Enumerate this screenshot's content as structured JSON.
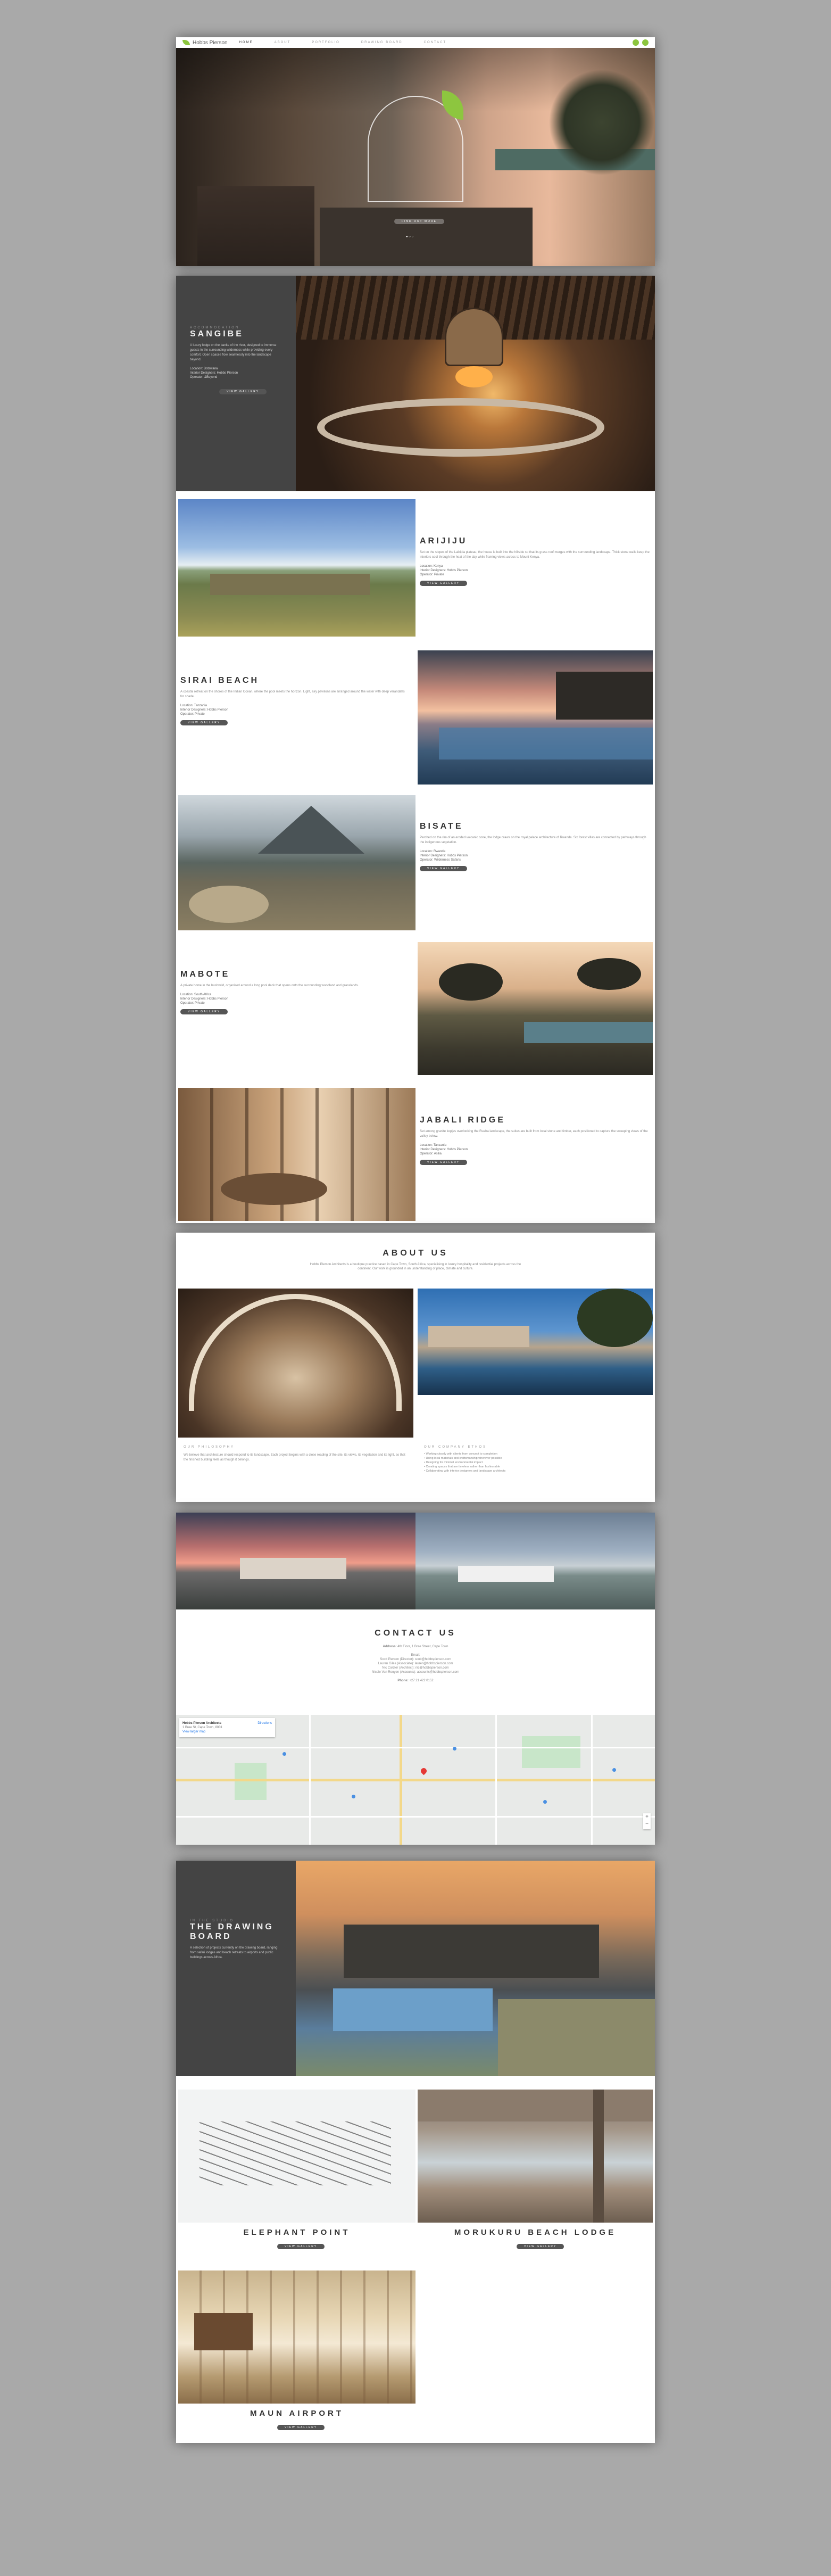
{
  "nav": {
    "logo": "Hobbs Pierson",
    "links": [
      "HOME",
      "ABOUT",
      "PORTFOLIO",
      "DRAWING BOARD",
      "CONTACT"
    ]
  },
  "hero": {
    "button": "FIND OUT MORE",
    "dots": "● ○ ○"
  },
  "sanctuary": {
    "eyebrow": "ACCOMMODATION",
    "title": "SANGIBE",
    "body": "A luxury lodge on the banks of the river, designed to immerse guests in the surrounding wilderness while providing every comfort. Open spaces flow seamlessly into the landscape beyond.",
    "location": "Location: Botswana",
    "interior": "Interior Designers: Hobbs Pierson",
    "operator": "Operator: &Beyond",
    "button": "VIEW GALLERY"
  },
  "projects": [
    {
      "title": "ARIJIJU",
      "body": "Set on the slopes of the Laikipia plateau, the house is built into the hillside so that its grass roof merges with the surrounding landscape. Thick stone walls keep the interiors cool through the heat of the day while framing views across to Mount Kenya.",
      "location": "Location: Kenya",
      "interior": "Interior Designers: Hobbs Pierson",
      "operator": "Operator: Private",
      "button": "VIEW GALLERY"
    },
    {
      "title": "SIRAI BEACH",
      "body": "A coastal retreat on the shores of the Indian Ocean, where the pool meets the horizon. Light, airy pavilions are arranged around the water with deep verandahs for shade.",
      "location": "Location: Tanzania",
      "interior": "Interior Designers: Hobbs Pierson",
      "operator": "Operator: Private",
      "button": "VIEW GALLERY"
    },
    {
      "title": "BISATE",
      "body": "Perched on the rim of an eroded volcanic cone, the lodge draws on the royal palace architecture of Rwanda. Six forest villas are connected by pathways through the indigenous vegetation.",
      "location": "Location: Rwanda",
      "interior": "Interior Designers: Hobbs Pierson",
      "operator": "Operator: Wilderness Safaris",
      "button": "VIEW GALLERY"
    },
    {
      "title": "MABOTE",
      "body": "A private home in the bushveld, organised around a long pool deck that opens onto the surrounding woodland and grasslands.",
      "location": "Location: South Africa",
      "interior": "Interior Designers: Hobbs Pierson",
      "operator": "Operator: Private",
      "button": "VIEW GALLERY"
    },
    {
      "title": "JABALI RIDGE",
      "body": "Set among granite kopjes overlooking the Ruaha landscape, the suites are built from local stone and timber, each positioned to capture the sweeping views of the valley below.",
      "location": "Location: Tanzania",
      "interior": "Interior Designers: Hobbs Pierson",
      "operator": "Operator: Asilia",
      "button": "VIEW GALLERY"
    }
  ],
  "about": {
    "title": "ABOUT US",
    "intro": "Hobbs Pierson Architects is a boutique practice based in Cape Town, South Africa, specialising in luxury hospitality and residential projects across the continent. Our work is grounded in an understanding of place, climate and culture.",
    "col1_title": "OUR PHILOSOPHY",
    "col1_body": "We believe that architecture should respond to its landscape. Each project begins with a close reading of the site, its views, its vegetation and its light, so that the finished building feels as though it belongs.",
    "col2_title": "OUR COMPANY ETHOS",
    "col2_items": [
      "Working closely with clients from concept to completion",
      "Using local materials and craftsmanship wherever possible",
      "Designing for minimal environmental impact",
      "Creating spaces that are timeless rather than fashionable",
      "Collaborating with interior designers and landscape architects"
    ]
  },
  "contact": {
    "title": "CONTACT US",
    "address_label": "Address:",
    "address": "4th Floor, 1 Bree Street, Cape Town",
    "email_label": "Email:",
    "emails": [
      "Scott Pierson (Director): scott@hobbspierson.com",
      "Lauren Giles (Associate): lauren@hobbspierson.com",
      "Nic Cordier (Architect): nic@hobbspierson.com",
      "Nicole Van Rooyen (Accounts): accounts@hobbspierson.com"
    ],
    "phone_label": "Phone:",
    "phone": "+27 21 422 0152"
  },
  "map": {
    "card_title": "Hobbs Pierson Architects",
    "card_address": "1 Bree St, Cape Town, 8001",
    "card_link": "View larger map",
    "directions": "Directions"
  },
  "drawing_board": {
    "eyebrow": "IN THE STUDIO",
    "title": "THE DRAWING BOARD",
    "body": "A selection of projects currently on the drawing board, ranging from safari lodges and beach retreats to airports and public buildings across Africa.",
    "items": [
      {
        "title": "ELEPHANT POINT",
        "button": "VIEW GALLERY"
      },
      {
        "title": "MORUKURU BEACH LODGE",
        "button": "VIEW GALLERY"
      },
      {
        "title": "MAUN AIRPORT",
        "button": "VIEW GALLERY"
      }
    ]
  },
  "colors": {
    "accent": "#8dc63f",
    "dark_panel": "#444444",
    "background": "#a9a9a9"
  }
}
